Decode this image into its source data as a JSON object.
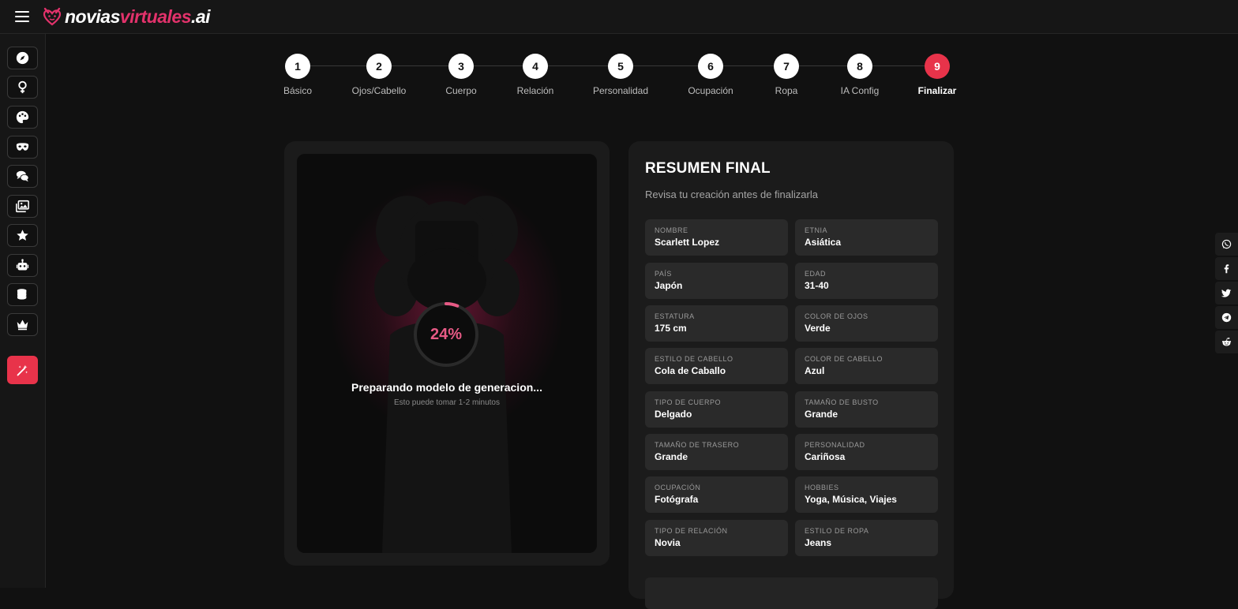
{
  "app": {
    "logo_part1": "novias",
    "logo_part2": "virtuales",
    "logo_part3": ".ai"
  },
  "sidebar": {
    "items": [
      {
        "icon": "compass-icon"
      },
      {
        "icon": "female-icon"
      },
      {
        "icon": "palette-icon"
      },
      {
        "icon": "mask-icon"
      },
      {
        "icon": "chat-icon"
      },
      {
        "icon": "gallery-icon"
      },
      {
        "icon": "star-icon"
      },
      {
        "icon": "robot-icon"
      },
      {
        "icon": "coins-icon"
      },
      {
        "icon": "crown-icon"
      },
      {
        "icon": "magic-wand-icon"
      }
    ]
  },
  "steps": [
    {
      "number": "1",
      "label": "Básico"
    },
    {
      "number": "2",
      "label": "Ojos/Cabello"
    },
    {
      "number": "3",
      "label": "Cuerpo"
    },
    {
      "number": "4",
      "label": "Relación"
    },
    {
      "number": "5",
      "label": "Personalidad"
    },
    {
      "number": "6",
      "label": "Ocupación"
    },
    {
      "number": "7",
      "label": "Ropa"
    },
    {
      "number": "8",
      "label": "IA Config"
    },
    {
      "number": "9",
      "label": "Finalizar"
    }
  ],
  "active_step": 9,
  "generation": {
    "progress_percent": 24,
    "progress_label": "24%",
    "title": "Preparando modelo de generacion...",
    "subtitle": "Esto puede tomar 1-2 minutos"
  },
  "summary": {
    "title": "RESUMEN FINAL",
    "subtitle": "Revisa tu creación antes de finalizarla",
    "fields": [
      {
        "label": "Nombre",
        "value": "Scarlett Lopez"
      },
      {
        "label": "Etnia",
        "value": "Asiática"
      },
      {
        "label": "País",
        "value": "Japón"
      },
      {
        "label": "Edad",
        "value": "31-40"
      },
      {
        "label": "Estatura",
        "value": "175 cm"
      },
      {
        "label": "Color de ojos",
        "value": "Verde"
      },
      {
        "label": "Estilo de cabello",
        "value": "Cola de Caballo"
      },
      {
        "label": "Color de cabello",
        "value": "Azul"
      },
      {
        "label": "Tipo de cuerpo",
        "value": "Delgado"
      },
      {
        "label": "Tamaño de busto",
        "value": "Grande"
      },
      {
        "label": "Tamaño de trasero",
        "value": "Grande"
      },
      {
        "label": "Personalidad",
        "value": "Cariñosa"
      },
      {
        "label": "Ocupación",
        "value": "Fotógrafa"
      },
      {
        "label": "Hobbies",
        "value": "Yoga, Música, Viajes"
      },
      {
        "label": "Tipo de relación",
        "value": "Novia"
      },
      {
        "label": "Estilo de ropa",
        "value": "Jeans"
      }
    ]
  },
  "share": [
    {
      "icon": "whatsapp-icon"
    },
    {
      "icon": "facebook-icon"
    },
    {
      "icon": "twitter-icon"
    },
    {
      "icon": "telegram-icon"
    },
    {
      "icon": "reddit-icon"
    }
  ],
  "colors": {
    "accent": "#e8334a",
    "progress": "#e65a85",
    "background": "#111111",
    "card": "#1b1b1b"
  }
}
